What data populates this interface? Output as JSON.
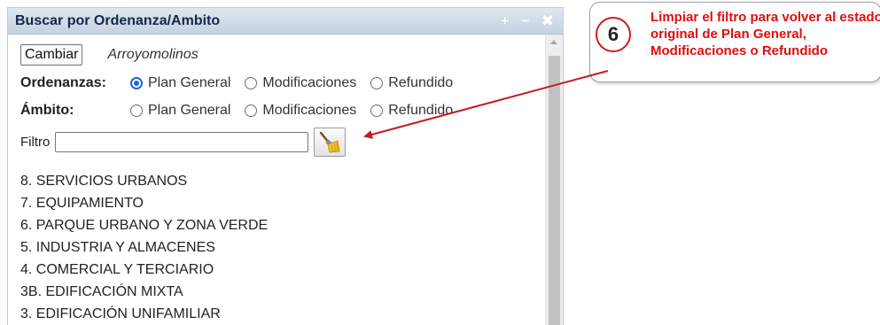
{
  "panel": {
    "title": "Buscar por Ordenanza/Ambito",
    "controls": {
      "add": "+",
      "minimize": "−",
      "close": "✖"
    }
  },
  "toolbar": {
    "change_label": "Cambiar",
    "location": "Arroyomolinos"
  },
  "ordenanzas": {
    "label": "Ordenanzas:",
    "options": [
      "Plan General",
      "Modificaciones",
      "Refundido"
    ],
    "selected": "Plan General"
  },
  "ambito": {
    "label": "Ámbito:",
    "options": [
      "Plan General",
      "Modificaciones",
      "Refundido"
    ],
    "selected": ""
  },
  "filter": {
    "label": "Filtro",
    "value": "",
    "placeholder": "",
    "clear_icon": "broom-icon"
  },
  "items": [
    "8. SERVICIOS URBANOS",
    "7. EQUIPAMIENTO",
    "6. PARQUE URBANO Y ZONA VERDE",
    "5. INDUSTRIA Y ALMACENES",
    "4. COMERCIAL Y TERCIARIO",
    "3B. EDIFICACIÓN MIXTA",
    "3. EDIFICACIÓN UNIFAMILIAR"
  ],
  "callout": {
    "step": "6",
    "text": "Limpiar el filtro para volver al estado original de Plan General, Modificaciones o Refundido"
  },
  "colors": {
    "accent_red": "#e00d0d",
    "radio_checked": "#1a66d6",
    "title_text": "#14284a"
  }
}
